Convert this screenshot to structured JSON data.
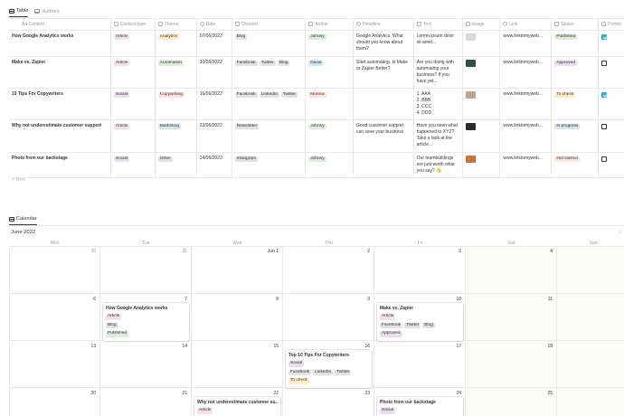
{
  "tabs": {
    "table": "Table",
    "authors": "Authors",
    "calendar": "Calendar"
  },
  "columns": [
    "Aa Content",
    "Content type",
    "Theme",
    "Date",
    "Channel",
    "Author",
    "Headline",
    "Text",
    "Image",
    "Link",
    "Status",
    "Promo"
  ],
  "rows": [
    {
      "name": "How Google Analytics works",
      "type": "Article",
      "theme": "Analytics",
      "date": "07/06/2022",
      "channels": [
        "Blog"
      ],
      "author": "Johnny",
      "headline": "Google Analytics. What should you know about them?",
      "text": "Lorem ipsum dolor sit amet...",
      "link": "www.linktomyweb...",
      "status": "Published",
      "promo": true
    },
    {
      "name": "Make vs. Zapier",
      "type": "Article",
      "theme": "Automation",
      "date": "10/06/2022",
      "channels": [
        "Facebook",
        "Twitter",
        "Blog"
      ],
      "author": "David",
      "headline": "Start automating. Is Make or Zapier Better?",
      "text": "Are you doing with automating your business? If you have yet...",
      "link": "www.linktomyweb...",
      "status": "Approved",
      "promo": false
    },
    {
      "name": "10 Tips For Copywriters",
      "type": "Social",
      "theme": "Copywriting",
      "date": "16/06/2022",
      "channels": [
        "Facebook",
        "LinkedIn",
        "Twitter"
      ],
      "author": "Monica",
      "headline": "",
      "text": "1. AAA\n2. BBB\n3. CCC\n4. DDD",
      "link": "www.linktomyweb...",
      "status": "To check",
      "promo": true
    },
    {
      "name": "Why not underestimate customer support",
      "type": "Article",
      "theme": "Marketing",
      "date": "22/06/2022",
      "channels": [
        "Newsletter"
      ],
      "author": "Johnny",
      "headline": "Good customer support can save your business",
      "text": "Have you seen what happened to XYZ? Take a look at the article...",
      "link": "www.linktomyweb...",
      "status": "In progress",
      "promo": false
    },
    {
      "name": "Photo from our backstage",
      "type": "Social",
      "theme": "Other",
      "date": "24/06/2022",
      "channels": [
        "Instagram"
      ],
      "author": "Johnny",
      "headline": "",
      "text": "Our teambuildings are just worth what you say? 👋",
      "link": "www.linktomyweb...",
      "status": "Not started",
      "promo": false
    }
  ],
  "new_label": "+ New",
  "calendar": {
    "month": "June 2022",
    "nav": "‹",
    "weekdays": [
      "Mon",
      "Tue",
      "Wed",
      "Thu",
      "Fri",
      "Sat",
      "Sun"
    ],
    "weeks": [
      [
        "30",
        "31",
        "Jun 1",
        "2",
        "3",
        "4",
        ""
      ],
      [
        "6",
        "7",
        "8",
        "9",
        "10",
        "11",
        ""
      ],
      [
        "13",
        "14",
        "15",
        "16",
        "17",
        "18",
        ""
      ],
      [
        "20",
        "21",
        "22",
        "23",
        "24",
        "25",
        ""
      ]
    ],
    "cards": [
      {
        "week": 1,
        "day": 1,
        "title": "How Google Analytics works",
        "tags": [
          [
            "Article"
          ],
          [
            "Blog"
          ],
          [
            "Published"
          ]
        ]
      },
      {
        "week": 1,
        "day": 4,
        "title": "Make vs. Zapier",
        "tags": [
          [
            "Article"
          ],
          [
            "Facebook",
            "Twitter",
            "Blog"
          ],
          [
            "Approved"
          ]
        ]
      },
      {
        "week": 2,
        "day": 3,
        "title": "Top 10 Tips For Copywriters",
        "tags": [
          [
            "Social"
          ],
          [
            "Facebook",
            "LinkedIn",
            "Twitter"
          ],
          [
            "To check"
          ]
        ]
      },
      {
        "week": 3,
        "day": 2,
        "title": "Why not underestimate customer su...",
        "tags": [
          [
            "Article"
          ]
        ]
      },
      {
        "week": 3,
        "day": 4,
        "title": "Photo from our backstage",
        "tags": [
          [
            "Social"
          ]
        ]
      }
    ]
  },
  "tag_colors": {
    "Article": "#f4dfeb",
    "Social": "#e8deee",
    "Analytics": "#fdecc8",
    "Automation": "#dbeddb",
    "Copywriting": "#ffe2dd",
    "Marketing": "#d3e5ef",
    "Other": "#e3e2e0",
    "Johnny": "#dbeddb",
    "David": "#d3e5ef",
    "Monica": "#ffe2dd",
    "Published": "#dbeddb",
    "Approved": "#e8deee",
    "To check": "#fdecc8",
    "In progress": "#d3e5ef",
    "Not started": "#ffe2dd",
    "channel": "#e3e2e0"
  },
  "thumb_colors": [
    "#d9d9d6",
    "#3a4a45",
    "#b9a68d",
    "#2d2d2d",
    "#c8743a"
  ]
}
